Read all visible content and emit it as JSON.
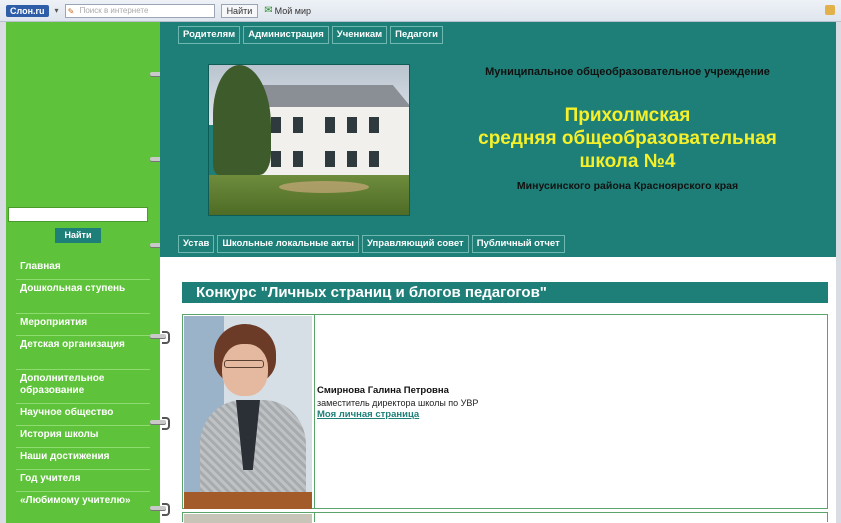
{
  "browser": {
    "logo": "Слон.ru",
    "search_placeholder": "Поиск в интернете",
    "find_button": "Найти",
    "mail_link": "Мой мир"
  },
  "topnav": [
    "Родителям",
    "Администрация",
    "Ученикам",
    "Педагоги"
  ],
  "header": {
    "subtitle": "Муниципальное общеобразовательное учреждение",
    "title_lines": [
      "Прихолмская",
      "средняя общеобразовательная",
      "школа №4"
    ],
    "region": "Минусинского района Красноярского края"
  },
  "subnav": [
    "Устав",
    "Школьные локальные акты",
    "Управляющий совет",
    "Публичный отчет"
  ],
  "sidebar": {
    "search_value": "",
    "find_button": "Найти",
    "items": [
      "Главная",
      "Дошкольная ступень",
      "Мероприятия",
      "Детская организация",
      "Дополнительное образование",
      "Научное общество",
      "История школы",
      "Наши достижения",
      "Год учителя",
      "«Любимому учителю»"
    ]
  },
  "content": {
    "banner": "Конкурс \"Личных страниц и блогов педагогов\"",
    "teacher": {
      "name": "Смирнова Галина Петровна",
      "role": "заместитель директора школы по УВР",
      "link": "Моя личная страница"
    }
  },
  "colors": {
    "sidebar_green": "#5ec33a",
    "header_teal": "#1e7f78",
    "title_yellow": "#f5f02a"
  }
}
